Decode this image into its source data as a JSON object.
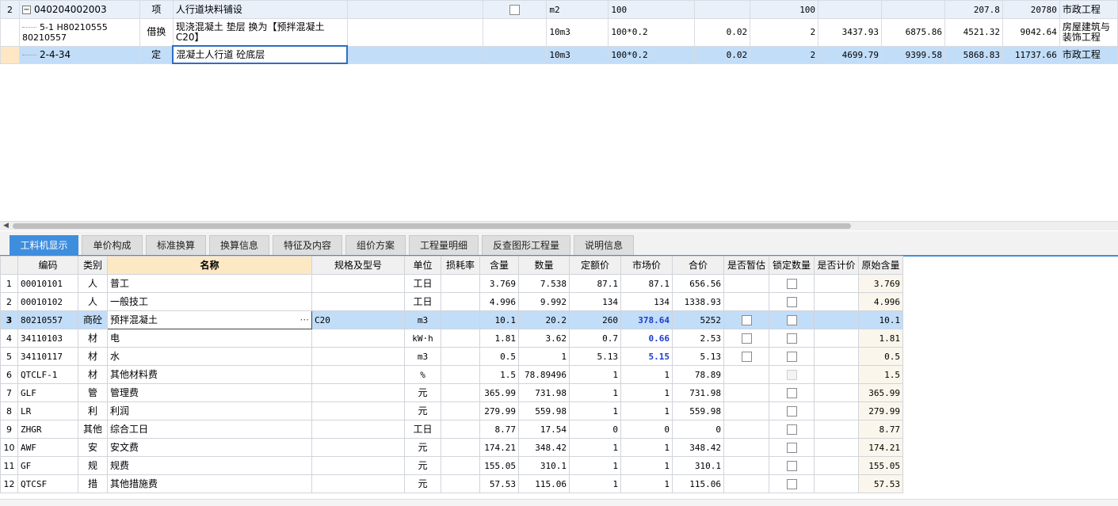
{
  "top_grid": {
    "rows": [
      {
        "rownum": "2",
        "code": "040204002003",
        "type": "项",
        "name": "人行道块料铺设",
        "feature": "",
        "check": true,
        "unit": "m2",
        "qty_expr": "100",
        "content": "",
        "qty": "100",
        "c1": "",
        "c2": "",
        "c3": "207.8",
        "c4": "20780",
        "profession": "市政工程"
      },
      {
        "rownum": "",
        "code": "5-1 H80210555 80210557",
        "type": "借换",
        "name": "现浇混凝土 垫层  换为【预拌混凝土 C20】",
        "feature": "",
        "check": false,
        "unit": "10m3",
        "qty_expr": "100*0.2",
        "content": "0.02",
        "qty": "2",
        "c1": "3437.93",
        "c2": "6875.86",
        "c3": "4521.32",
        "c4": "9042.64",
        "profession": "房屋建筑与装饰工程"
      },
      {
        "rownum": "",
        "code": "2-4-34",
        "type": "定",
        "name": "混凝土人行道 砼底层",
        "feature": "",
        "check": false,
        "unit": "10m3",
        "qty_expr": "100*0.2",
        "content": "0.02",
        "qty": "2",
        "c1": "4699.79",
        "c2": "9399.58",
        "c3": "5868.83",
        "c4": "11737.66",
        "profession": "市政工程"
      }
    ]
  },
  "tabs": [
    "工料机显示",
    "单价构成",
    "标准换算",
    "换算信息",
    "特征及内容",
    "组价方案",
    "工程量明细",
    "反查图形工程量",
    "说明信息"
  ],
  "active_tab": 0,
  "bottom_grid": {
    "headers": [
      "编码",
      "类别",
      "名称",
      "规格及型号",
      "单位",
      "损耗率",
      "含量",
      "数量",
      "定额价",
      "市场价",
      "合价",
      "是否暂估",
      "锁定数量",
      "是否计价",
      "原始含量"
    ],
    "rows": [
      {
        "n": "1",
        "code": "00010101",
        "cat": "人",
        "name": "普工",
        "spec": "",
        "unit": "工日",
        "loss": "",
        "content": "3.769",
        "qty": "7.538",
        "quota": "87.1",
        "market": "87.1",
        "total": "656.56",
        "est": "none",
        "lock": "box",
        "orig": "3.769",
        "blue": false
      },
      {
        "n": "2",
        "code": "00010102",
        "cat": "人",
        "name": "一般技工",
        "spec": "",
        "unit": "工日",
        "loss": "",
        "content": "4.996",
        "qty": "9.992",
        "quota": "134",
        "market": "134",
        "total": "1338.93",
        "est": "none",
        "lock": "box",
        "orig": "4.996",
        "blue": false
      },
      {
        "n": "3",
        "code": "80210557",
        "cat": "商砼",
        "name": "预拌混凝土",
        "spec": "C20",
        "unit": "m3",
        "loss": "",
        "content": "10.1",
        "qty": "20.2",
        "quota": "260",
        "market": "378.64",
        "total": "5252",
        "est": "box",
        "lock": "box",
        "orig": "10.1",
        "blue": true
      },
      {
        "n": "4",
        "code": "34110103",
        "cat": "材",
        "name": "电",
        "spec": "",
        "unit": "kW·h",
        "loss": "",
        "content": "1.81",
        "qty": "3.62",
        "quota": "0.7",
        "market": "0.66",
        "total": "2.53",
        "est": "box",
        "lock": "box",
        "orig": "1.81",
        "blue": true
      },
      {
        "n": "5",
        "code": "34110117",
        "cat": "材",
        "name": "水",
        "spec": "",
        "unit": "m3",
        "loss": "",
        "content": "0.5",
        "qty": "1",
        "quota": "5.13",
        "market": "5.15",
        "total": "5.13",
        "est": "box",
        "lock": "box",
        "orig": "0.5",
        "blue": true
      },
      {
        "n": "6",
        "code": "QTCLF-1",
        "cat": "材",
        "name": "其他材料费",
        "spec": "",
        "unit": "%",
        "loss": "",
        "content": "1.5",
        "qty": "78.89496",
        "quota": "1",
        "market": "1",
        "total": "78.89",
        "est": "none",
        "lock": "dis",
        "orig": "1.5",
        "blue": false
      },
      {
        "n": "7",
        "code": "GLF",
        "cat": "管",
        "name": "管理费",
        "spec": "",
        "unit": "元",
        "loss": "",
        "content": "365.99",
        "qty": "731.98",
        "quota": "1",
        "market": "1",
        "total": "731.98",
        "est": "none",
        "lock": "box",
        "orig": "365.99",
        "blue": false
      },
      {
        "n": "8",
        "code": "LR",
        "cat": "利",
        "name": "利润",
        "spec": "",
        "unit": "元",
        "loss": "",
        "content": "279.99",
        "qty": "559.98",
        "quota": "1",
        "market": "1",
        "total": "559.98",
        "est": "none",
        "lock": "box",
        "orig": "279.99",
        "blue": false
      },
      {
        "n": "9",
        "code": "ZHGR",
        "cat": "其他",
        "name": "综合工日",
        "spec": "",
        "unit": "工日",
        "loss": "",
        "content": "8.77",
        "qty": "17.54",
        "quota": "0",
        "market": "0",
        "total": "0",
        "est": "none",
        "lock": "box",
        "orig": "8.77",
        "blue": false
      },
      {
        "n": "10",
        "code": "AWF",
        "cat": "安",
        "name": "安文费",
        "spec": "",
        "unit": "元",
        "loss": "",
        "content": "174.21",
        "qty": "348.42",
        "quota": "1",
        "market": "1",
        "total": "348.42",
        "est": "none",
        "lock": "box",
        "orig": "174.21",
        "blue": false
      },
      {
        "n": "11",
        "code": "GF",
        "cat": "规",
        "name": "规费",
        "spec": "",
        "unit": "元",
        "loss": "",
        "content": "155.05",
        "qty": "310.1",
        "quota": "1",
        "market": "1",
        "total": "310.1",
        "est": "none",
        "lock": "box",
        "orig": "155.05",
        "blue": false
      },
      {
        "n": "12",
        "code": "QTCSF",
        "cat": "措",
        "name": "其他措施费",
        "spec": "",
        "unit": "元",
        "loss": "",
        "content": "57.53",
        "qty": "115.06",
        "quota": "1",
        "market": "1",
        "total": "115.06",
        "est": "none",
        "lock": "box",
        "orig": "57.53",
        "blue": false
      }
    ]
  },
  "colors": {
    "accent": "#3f8ede",
    "selected_row": "#c2ddf8",
    "blue_value": "#1a3ccf",
    "header_highlight": "#fde8c4"
  },
  "icons": {
    "collapse": "minus-box-icon",
    "ellipsis": "ellipsis-icon",
    "scroll_left": "arrow-left-icon"
  }
}
